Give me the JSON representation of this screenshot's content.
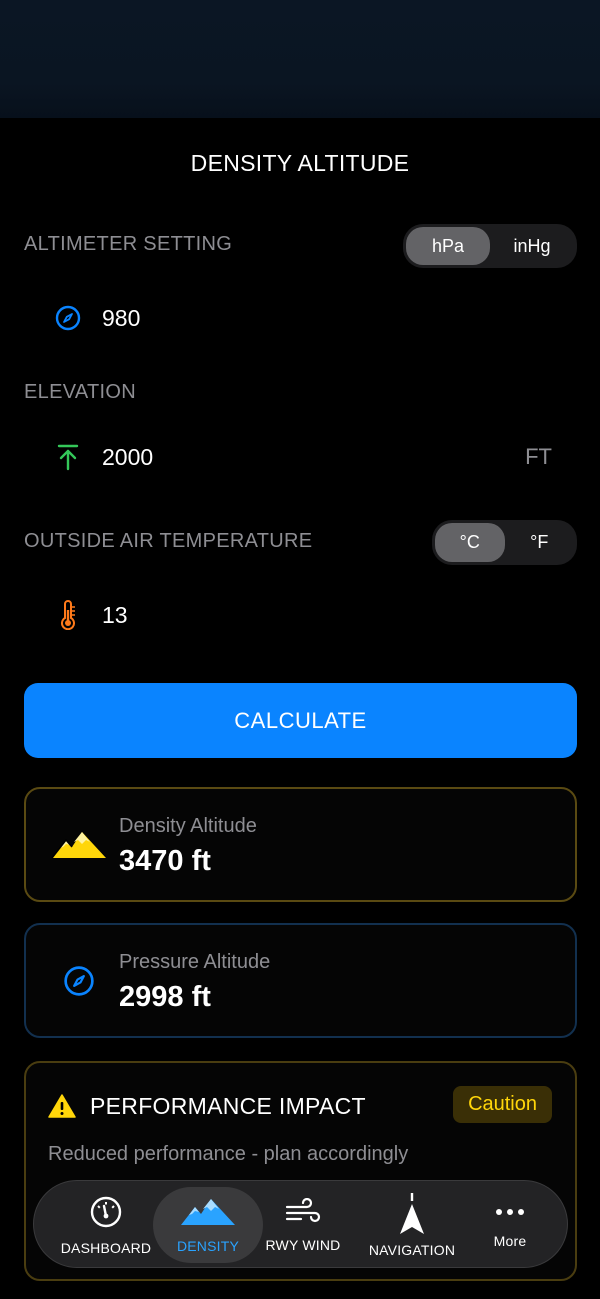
{
  "page": {
    "title": "DENSITY ALTITUDE"
  },
  "altimeter": {
    "label": "ALTIMETER SETTING",
    "units": [
      "hPa",
      "inHg"
    ],
    "selected": "hPa",
    "value": "980",
    "icon": "compass-icon"
  },
  "elevation": {
    "label": "ELEVATION",
    "value": "2000",
    "unit": "FT",
    "icon": "arrow-up-icon"
  },
  "temperature": {
    "label": "OUTSIDE AIR TEMPERATURE",
    "units": [
      "°C",
      "°F"
    ],
    "selected": "°C",
    "value": "13",
    "icon": "thermometer-icon"
  },
  "calculate": {
    "label": "CALCULATE"
  },
  "results": {
    "density": {
      "label": "Density Altitude",
      "value": "3470 ft",
      "icon": "mountains-icon"
    },
    "pressure": {
      "label": "Pressure Altitude",
      "value": "2998 ft",
      "icon": "compass-icon"
    }
  },
  "performance": {
    "title": "PERFORMANCE IMPACT",
    "badge": "Caution",
    "description": "Reduced performance - plan accordingly",
    "icon": "warning-icon"
  },
  "tabs": [
    {
      "label": "DASHBOARD",
      "icon": "gauge-icon"
    },
    {
      "label": "DENSITY",
      "icon": "mountains-icon",
      "active": true
    },
    {
      "label": "RWY WIND",
      "icon": "wind-icon"
    },
    {
      "label": "NAVIGATION",
      "icon": "navigation-arrow-icon"
    },
    {
      "label": "More",
      "icon": "ellipsis-icon"
    }
  ],
  "colors": {
    "accent": "#0a84ff",
    "caution": "#ffd60a",
    "densityBorder": "#5a4a12",
    "pressureBorder": "#12304f",
    "elevationIcon": "#34c759",
    "temperatureIcon": "#ff7a1a"
  }
}
